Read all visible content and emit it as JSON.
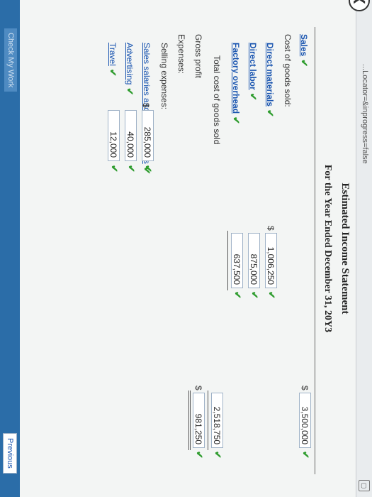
{
  "browser": {
    "url_fragment": "...Locator=&inprogress=false"
  },
  "statement": {
    "title": "Estimated Income Statement",
    "period": "For the Year Ended December 31, 20Y3"
  },
  "lines": {
    "sales": {
      "label": "Sales",
      "amount": "3,500,000"
    },
    "cogs_header": "Cost of goods sold:",
    "direct_materials": {
      "label": "Direct materials",
      "amount": "1,006,250"
    },
    "direct_labor": {
      "label": "Direct labor",
      "amount": "875,000"
    },
    "factory_overhead": {
      "label": "Factory overhead",
      "amount": "637,500"
    },
    "total_cogs": {
      "label": "Total cost of goods sold",
      "amount": "2,518,750"
    },
    "gross_profit": {
      "label": "Gross profit",
      "amount": "981,250"
    },
    "expenses_header": "Expenses:",
    "selling_header": "Selling expenses:",
    "sales_salaries": {
      "label": "Sales salaries and commissions",
      "amount": "285,000"
    },
    "advertising": {
      "label": "Advertising",
      "amount": "40,000"
    },
    "travel": {
      "label": "Travel",
      "amount": "12,000"
    }
  },
  "symbols": {
    "check": "✔",
    "dollar": "$",
    "back": "❮"
  },
  "footer": {
    "check_my_work": "Check My Work",
    "previous": "Previous"
  },
  "colors": {
    "link": "#1a55b0",
    "check": "#2e9c2e",
    "footer": "#2b6da8"
  }
}
